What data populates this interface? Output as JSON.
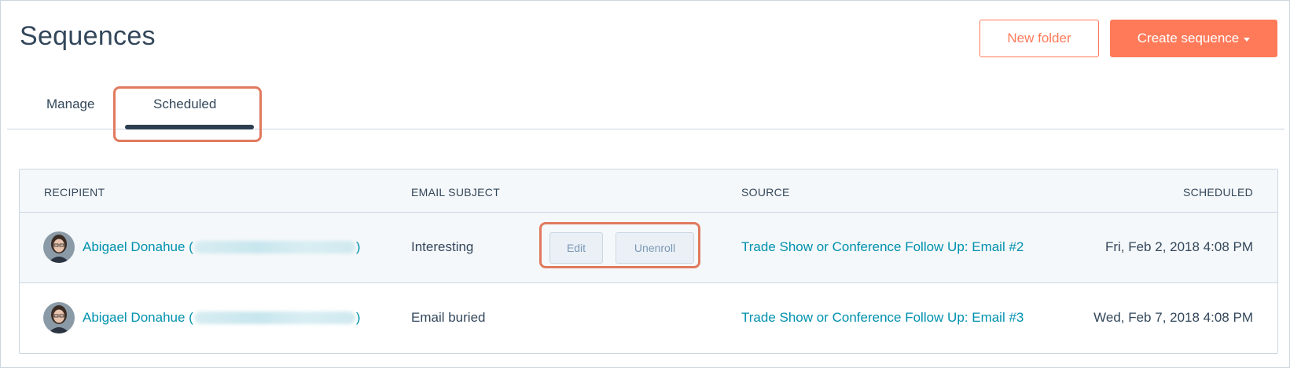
{
  "header": {
    "title": "Sequences",
    "new_folder_label": "New folder",
    "create_sequence_label": "Create sequence"
  },
  "tabs": [
    {
      "label": "Manage"
    },
    {
      "label": "Scheduled"
    }
  ],
  "table": {
    "columns": {
      "recipient": "RECIPIENT",
      "email_subject": "EMAIL SUBJECT",
      "source": "SOURCE",
      "scheduled": "SCHEDULED"
    },
    "actions": {
      "edit_label": "Edit",
      "unenroll_label": "Unenroll"
    },
    "rows": [
      {
        "recipient_name": "Abigael Donahue (",
        "recipient_close": ")",
        "subject": "Interesting",
        "source": "Trade Show or Conference Follow Up: Email #2",
        "scheduled": "Fri, Feb 2, 2018 4:08 PM"
      },
      {
        "recipient_name": "Abigael Donahue (",
        "recipient_close": ")",
        "subject": "Email buried",
        "source": "Trade Show or Conference Follow Up: Email #3",
        "scheduled": "Wed, Feb 7, 2018 4:08 PM"
      }
    ]
  },
  "colors": {
    "accent": "#ff7a59",
    "link": "#0091ae",
    "text": "#33475b",
    "highlight": "#e07a5f"
  }
}
